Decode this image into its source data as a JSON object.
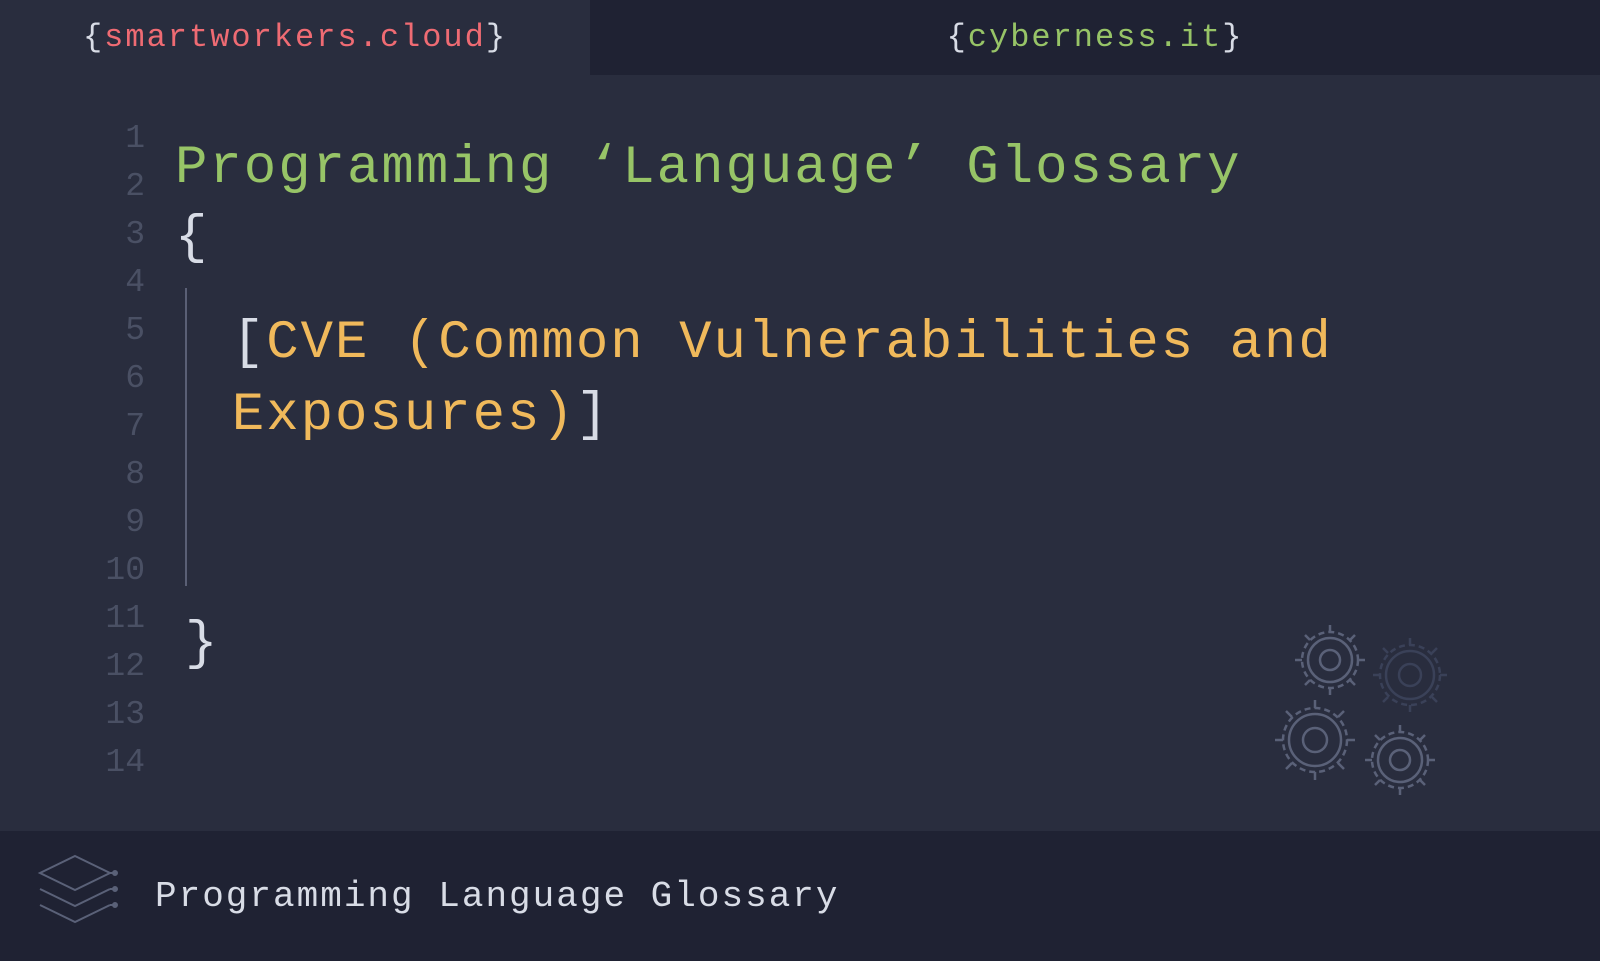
{
  "header": {
    "left": {
      "brace_open": "{",
      "brand": "smartworkers.cloud",
      "brace_close": "}"
    },
    "right": {
      "brace_open": "{",
      "brand": "cyberness.it",
      "brace_close": "}"
    }
  },
  "editor": {
    "line_numbers": [
      "1",
      "2",
      "3",
      "4",
      "5",
      "6",
      "7",
      "8",
      "9",
      "10",
      "11",
      "12",
      "13",
      "14"
    ],
    "title": "Programming ‘Language’ Glossary",
    "open_brace": "{",
    "bracket_open": "[",
    "content": "CVE (Common Vulnerabilities and Exposures)",
    "bracket_close": "]",
    "close_brace": "}"
  },
  "footer": {
    "text": "Programming Language Glossary"
  }
}
